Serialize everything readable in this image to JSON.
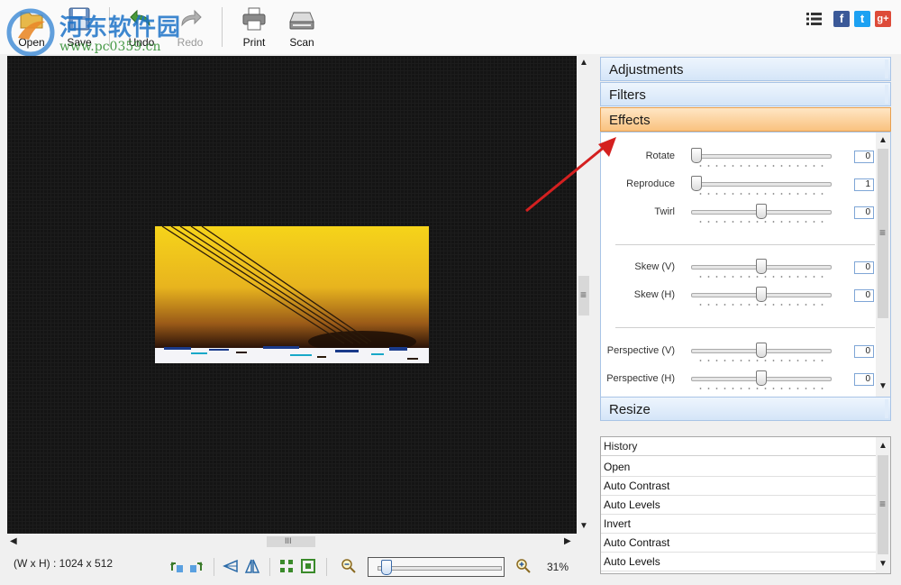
{
  "toolbar": {
    "open_label": "Open",
    "save_label": "Save",
    "undo_label": "Undo",
    "redo_label": "Redo",
    "print_label": "Print",
    "scan_label": "Scan"
  },
  "watermark": {
    "title": "河东软件园",
    "url": "www.pc0359.cn"
  },
  "social": {
    "facebook": "f",
    "twitter": "t",
    "googleplus": "g+"
  },
  "canvas": {
    "hscroll_grip": "III",
    "vscroll_grip": "≡"
  },
  "status": {
    "dimensions": "(W x H) : 1024 x 512",
    "zoom": "31%",
    "zoom_level": 0.03
  },
  "panel": {
    "sections": [
      "Adjustments",
      "Filters",
      "Effects",
      "Resize"
    ],
    "active": "Effects"
  },
  "effects": {
    "sliders": [
      {
        "label": "Rotate",
        "value": "0",
        "position": 0.0
      },
      {
        "label": "Reproduce",
        "value": "1",
        "position": 0.0
      },
      {
        "label": "Twirl",
        "value": "0",
        "position": 0.5
      },
      {
        "label": "Skew (V)",
        "value": "0",
        "position": 0.5
      },
      {
        "label": "Skew (H)",
        "value": "0",
        "position": 0.5
      },
      {
        "label": "Perspective (V)",
        "value": "0",
        "position": 0.5
      },
      {
        "label": "Perspective (H)",
        "value": "0",
        "position": 0.5
      }
    ],
    "scroll_grip": "≡"
  },
  "history": {
    "header": "History",
    "items": [
      "Open",
      "Auto Contrast",
      "Auto Levels",
      "Invert",
      "Auto Contrast",
      "Auto Levels"
    ],
    "scroll_grip": "≡"
  },
  "colors": {
    "accent_active": "#f9c27f",
    "panel_border": "#a9c4e6",
    "facebook": "#3b5998",
    "twitter": "#1da1f2",
    "googleplus": "#dd4b39",
    "annotation_arrow": "#d42020"
  }
}
